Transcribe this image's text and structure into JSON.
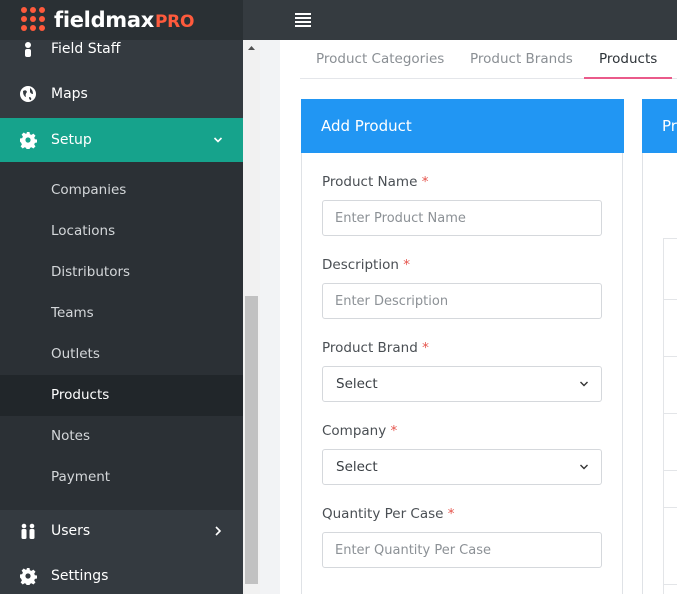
{
  "app": {
    "logo_text": "fieldmax",
    "logo_suffix": "PRO",
    "brand_color": "#ff5a3c",
    "accent_color": "#16a38c"
  },
  "sidebar": {
    "items": [
      {
        "label": "Field Staff",
        "icon": "field-staff-icon"
      },
      {
        "label": "Maps",
        "icon": "globe-icon"
      },
      {
        "label": "Setup",
        "icon": "gear-icon",
        "expanded": true
      },
      {
        "label": "Users",
        "icon": "users-icon"
      },
      {
        "label": "Settings",
        "icon": "gear-icon"
      }
    ],
    "setup_submenu": [
      {
        "label": "Companies"
      },
      {
        "label": "Locations"
      },
      {
        "label": "Distributors"
      },
      {
        "label": "Teams"
      },
      {
        "label": "Outlets"
      },
      {
        "label": "Products",
        "current": true
      },
      {
        "label": "Notes"
      },
      {
        "label": "Payment"
      }
    ]
  },
  "tabs": [
    {
      "label": "Product Categories"
    },
    {
      "label": "Product Brands"
    },
    {
      "label": "Products",
      "active": true
    }
  ],
  "form": {
    "title": "Add Product",
    "fields": {
      "product_name": {
        "label": "Product Name",
        "placeholder": "Enter Product Name",
        "required": "*"
      },
      "description": {
        "label": "Description",
        "placeholder": "Enter Description",
        "required": "*"
      },
      "product_brand": {
        "label": "Product Brand",
        "value": "Select",
        "required": "*"
      },
      "company": {
        "label": "Company",
        "value": "Select",
        "required": "*"
      },
      "quantity_per_case": {
        "label": "Quantity Per Case",
        "placeholder": "Enter Quantity Per Case",
        "required": "*"
      }
    }
  },
  "list_panel": {
    "title_fragment": "Pr"
  }
}
